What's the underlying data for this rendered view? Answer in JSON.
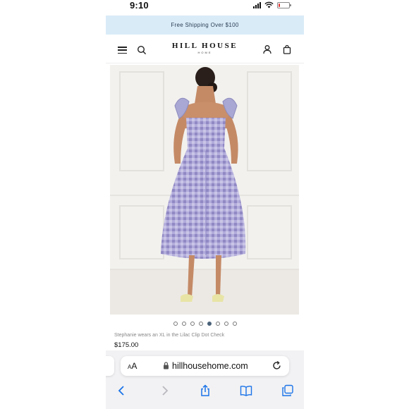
{
  "status_bar": {
    "time": "9:10",
    "battery_level": 0.15,
    "icons": [
      "cellular-signal-icon",
      "wifi-icon",
      "battery-icon"
    ]
  },
  "promo_banner": {
    "text": "Free Shipping Over $100",
    "background_color": "#d9ebf7"
  },
  "header": {
    "logo_main": "HILL HOUSE",
    "logo_sub": "HOME",
    "icons": [
      "menu-icon",
      "search-icon",
      "account-icon",
      "shopping-bag-icon"
    ]
  },
  "product": {
    "image_description_icon": "product-photo",
    "carousel": {
      "total": 8,
      "active_index": 4
    },
    "caption": "Stephanie wears an XL in the Lilac Clip Dot Check",
    "price": "$175.00"
  },
  "browser": {
    "aa_label_small": "A",
    "aa_label_large": "A",
    "url": "hillhousehome.com",
    "toolbar_icons": [
      "back-icon",
      "forward-icon",
      "share-icon",
      "bookmarks-icon",
      "tabs-icon"
    ],
    "accent_color": "#1a73e8"
  }
}
